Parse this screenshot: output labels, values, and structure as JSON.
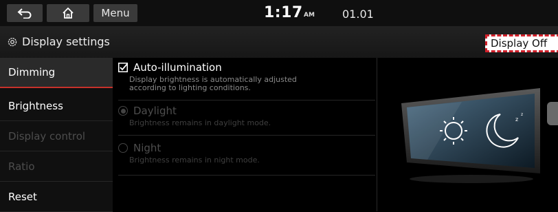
{
  "topbar": {
    "back_icon": "back-arrow-icon",
    "home_icon": "home-icon",
    "menu_label": "Menu",
    "time": "1:17",
    "ampm": "AM",
    "date": "01.01"
  },
  "header": {
    "icon": "gear-icon",
    "title": "Display settings",
    "display_off_label": "Display Off"
  },
  "sidebar": {
    "items": [
      {
        "label": "Dimming",
        "state": "active"
      },
      {
        "label": "Brightness",
        "state": "enabled"
      },
      {
        "label": "Display control",
        "state": "disabled"
      },
      {
        "label": "Ratio",
        "state": "disabled"
      },
      {
        "label": "Reset",
        "state": "enabled"
      }
    ]
  },
  "options": {
    "auto_illumination": {
      "checked": true,
      "title": "Auto-illumination",
      "desc_line1": "Display brightness is automatically adjusted",
      "desc_line2": "according to lighting conditions."
    },
    "daylight": {
      "selected": true,
      "disabled": true,
      "title": "Daylight",
      "desc": "Brightness remains in daylight mode."
    },
    "night": {
      "selected": false,
      "disabled": true,
      "title": "Night",
      "desc": "Brightness remains in night mode."
    }
  },
  "colors": {
    "accent_red": "#c7312b",
    "disabled_text": "#4d4d4d",
    "desc_text": "#8a8a8a"
  }
}
